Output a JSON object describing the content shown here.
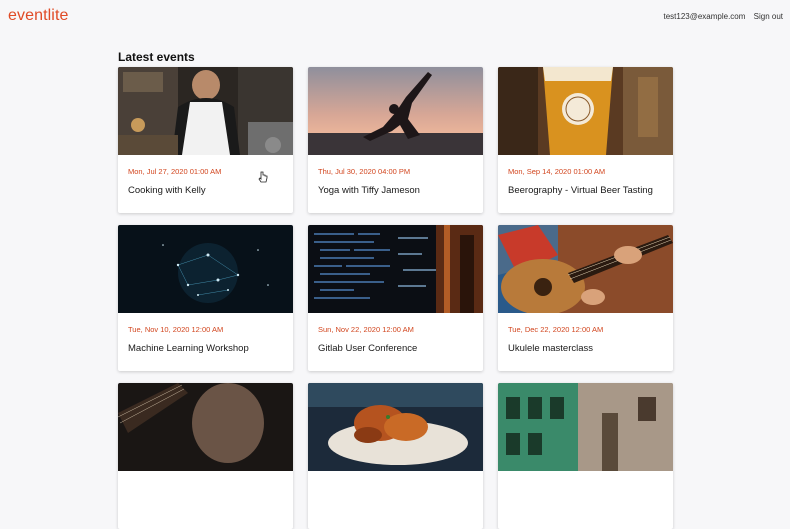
{
  "brand": "eventlite",
  "account": {
    "email": "test123@example.com",
    "signout": "Sign out"
  },
  "section_title": "Latest events",
  "events": [
    {
      "date": "Mon, Jul 27, 2020 01:00 AM",
      "title": "Cooking with Kelly"
    },
    {
      "date": "Thu, Jul 30, 2020 04:00 PM",
      "title": "Yoga with Tiffy Jameson"
    },
    {
      "date": "Mon, Sep 14, 2020 01:00 AM",
      "title": "Beerography - Virtual Beer Tasting"
    },
    {
      "date": "Tue, Nov 10, 2020 12:00 AM",
      "title": "Machine Learning Workshop"
    },
    {
      "date": "Sun, Nov 22, 2020 12:00 AM",
      "title": "Gitlab User Conference"
    },
    {
      "date": "Tue, Dec 22, 2020 12:00 AM",
      "title": "Ukulele masterclass"
    },
    {
      "date": "",
      "title": ""
    },
    {
      "date": "",
      "title": ""
    },
    {
      "date": "",
      "title": ""
    }
  ],
  "colors": {
    "brand": "#e04b26",
    "date": "#d2461f",
    "background": "#f7f7f9"
  }
}
